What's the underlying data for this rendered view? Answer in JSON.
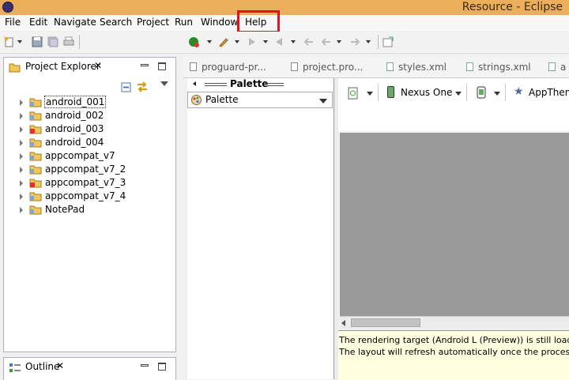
{
  "window": {
    "title": "Resource - Eclipse"
  },
  "menu": [
    "File",
    "Edit",
    "Navigate",
    "Search",
    "Project",
    "Run",
    "Window",
    "Help"
  ],
  "project_explorer": {
    "title": "Project Explorer",
    "items": [
      {
        "label": "android_001"
      },
      {
        "label": "android_002"
      },
      {
        "label": "android_003"
      },
      {
        "label": "android_004"
      },
      {
        "label": "appcompat_v7"
      },
      {
        "label": "appcompat_v7_2"
      },
      {
        "label": "appcompat_v7_3"
      },
      {
        "label": "appcompat_v7_4"
      },
      {
        "label": "NotePad"
      }
    ]
  },
  "outline": {
    "title": "Outline"
  },
  "editor_tabs": [
    "proguard-pr...",
    "project.pro...",
    "styles.xml",
    "strings.xml",
    "a"
  ],
  "palette": {
    "header": "Palette",
    "dropdown": "Palette"
  },
  "preview": {
    "device": "Nexus One",
    "theme": "AppTheme"
  },
  "messages": [
    "The rendering target (Android L (Preview)) is still loading.",
    "The layout will refresh automatically once the process is f"
  ]
}
